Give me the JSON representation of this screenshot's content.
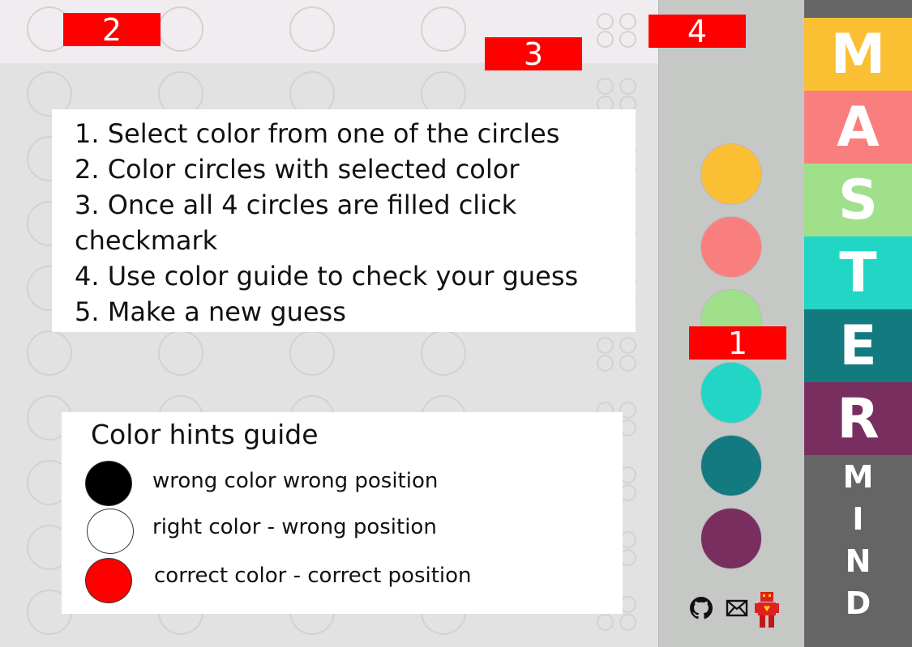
{
  "markers": [
    "1",
    "2",
    "3",
    "4"
  ],
  "instructions": [
    "1.  Select color from one of the circles",
    "2.  Color circles with selected color",
    "3.  Once all 4 circles are filled click checkmark",
    "4. Use color guide to check your guess",
    "5.  Make a new guess"
  ],
  "hints_guide": {
    "title": "Color hints guide",
    "items": [
      {
        "label": "wrong color wrong position",
        "color": "#000000"
      },
      {
        "label": "right color - wrong position",
        "color": "#ffffff"
      },
      {
        "label": "correct color - correct position",
        "color": "#ff0000"
      }
    ]
  },
  "palette": {
    "colors": [
      "#fbbf34",
      "#f97f7f",
      "#a0e08b",
      "#22d6c6",
      "#137a80",
      "#782f5f"
    ]
  },
  "footer_icons": [
    "github-icon",
    "mail-icon",
    "robot-icon"
  ],
  "title": {
    "letters": [
      {
        "char": "M",
        "color": "#fbbf34"
      },
      {
        "char": "A",
        "color": "#f97f7f"
      },
      {
        "char": "S",
        "color": "#a0e08b"
      },
      {
        "char": "T",
        "color": "#22d6c6"
      },
      {
        "char": "E",
        "color": "#137a80"
      },
      {
        "char": "R",
        "color": "#782f5f"
      }
    ],
    "mind": [
      "M",
      "I",
      "N",
      "D"
    ]
  }
}
